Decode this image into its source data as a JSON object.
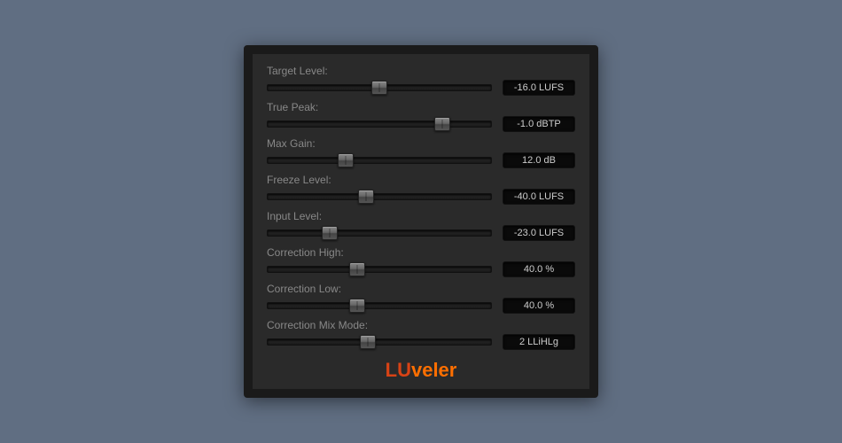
{
  "params": [
    {
      "label": "Target Level:",
      "value": "-16.0 LUFS",
      "position": 50
    },
    {
      "label": "True Peak:",
      "value": "-1.0 dBTP",
      "position": 78
    },
    {
      "label": "Max Gain:",
      "value": "12.0 dB",
      "position": 35
    },
    {
      "label": "Freeze Level:",
      "value": "-40.0 LUFS",
      "position": 44
    },
    {
      "label": "Input Level:",
      "value": "-23.0 LUFS",
      "position": 28
    },
    {
      "label": "Correction High:",
      "value": "40.0 %",
      "position": 40
    },
    {
      "label": "Correction Low:",
      "value": "40.0 %",
      "position": 40
    },
    {
      "label": "Correction Mix Mode:",
      "value": "2 LLiHLg",
      "position": 45
    }
  ],
  "logo": {
    "prefix": "LU",
    "suffix": "veler"
  }
}
